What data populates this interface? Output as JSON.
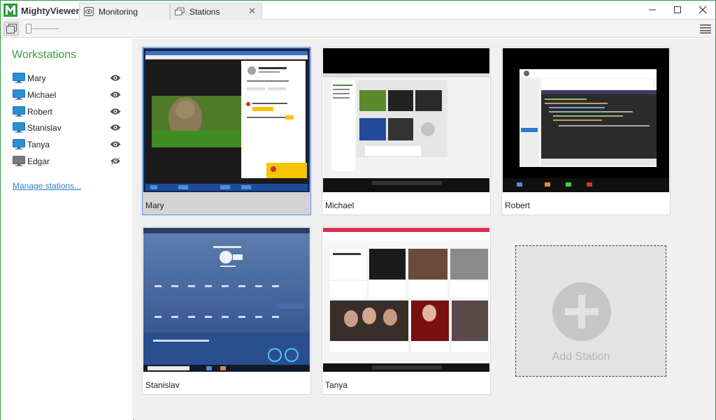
{
  "app": {
    "title": "MightyViewer",
    "accent": "#3aa040"
  },
  "tabs": [
    {
      "label": "Monitoring",
      "icon": "eye-icon",
      "active": true
    },
    {
      "label": "Stations",
      "icon": "stations-icon",
      "close": "✕"
    }
  ],
  "window_controls": [
    "minimize",
    "maximize",
    "close"
  ],
  "sidebar": {
    "title": "Workstations",
    "items": [
      {
        "name": "Mary",
        "visible": true
      },
      {
        "name": "Michael",
        "visible": true
      },
      {
        "name": "Robert",
        "visible": true
      },
      {
        "name": "Stanislav",
        "visible": true
      },
      {
        "name": "Tanya",
        "visible": true
      },
      {
        "name": "Edgar",
        "visible": false
      }
    ],
    "manage_link": "Manage stations..."
  },
  "stations": [
    {
      "label": "Mary",
      "selected": true
    },
    {
      "label": "Michael",
      "selected": false
    },
    {
      "label": "Robert",
      "selected": false
    },
    {
      "label": "Stanislav",
      "selected": false
    },
    {
      "label": "Tanya",
      "selected": false
    }
  ],
  "add_station": {
    "label": "Add Station"
  }
}
